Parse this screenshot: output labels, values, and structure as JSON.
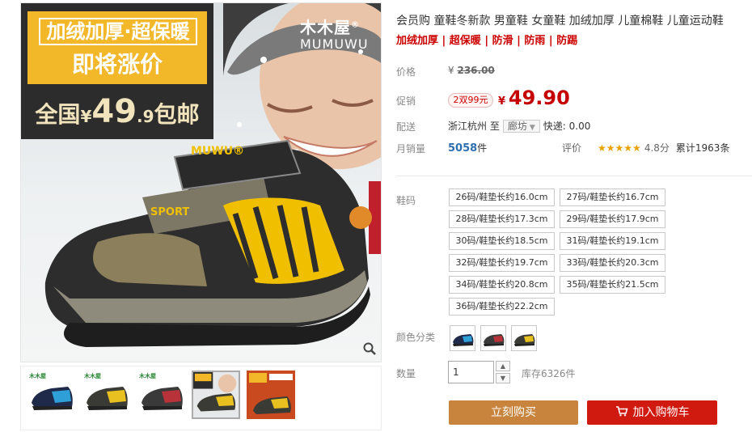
{
  "gallery": {
    "promo_line1": "加绒加厚·超保暖",
    "promo_line2": "即将涨价",
    "promo_price": {
      "prefix": "全国",
      "currency": "¥",
      "integer": "49",
      "decimal": ".9",
      "suffix": "包邮"
    },
    "brand_cn": "木木屋",
    "brand_mark": "®",
    "brand_en": "MUMUWU",
    "zoom_icon": "magnifier-icon",
    "thumb_brand": "木木屋"
  },
  "product": {
    "title": "会员购 童鞋冬新款 男童鞋 女童鞋 加绒加厚 儿童棉鞋 儿童运动鞋",
    "subtitle": "加绒加厚 | 超保暖 | 防滑 | 防雨 | 防踢"
  },
  "pricing": {
    "list_label": "价格",
    "list_currency": "¥",
    "list_value": "236.00",
    "promo_label": "促销",
    "promo_tag": "2双99元",
    "sale_currency": "¥",
    "sale_value": "49.90"
  },
  "shipping": {
    "label": "配送",
    "from": "浙江杭州 至",
    "to": "廊坊",
    "fee": "快递: 0.00"
  },
  "sales": {
    "label": "月销量",
    "count": "5058",
    "unit": "件",
    "rating_label": "评价",
    "stars": "★★★★★",
    "score": "4.8分",
    "reviews": "累计1963条"
  },
  "sku": {
    "size_label": "鞋码",
    "sizes": [
      "26码/鞋垫长约16.0cm",
      "27码/鞋垫长约16.7cm",
      "28码/鞋垫长约17.3cm",
      "29码/鞋垫长约17.9cm",
      "30码/鞋垫长约18.5cm",
      "31码/鞋垫长约19.1cm",
      "32码/鞋垫长约19.7cm",
      "33码/鞋垫长约20.3cm",
      "34码/鞋垫长约20.8cm",
      "35码/鞋垫长约21.5cm",
      "36码/鞋垫长约22.2cm"
    ],
    "color_label": "颜色分类"
  },
  "quantity": {
    "label": "数量",
    "value": "1",
    "up": "▲",
    "down": "▼",
    "stock": "库存6326件"
  },
  "actions": {
    "buy_now": "立刻购买",
    "add_to_cart": "加入购物车",
    "cart_icon": "shopping-cart-icon"
  },
  "colors": {
    "price_red": "#c40000",
    "buy_button": "#c8843c",
    "cart_button": "#d01a10",
    "promo_yellow": "#f3b72a",
    "link_blue": "#2f6fb0"
  }
}
